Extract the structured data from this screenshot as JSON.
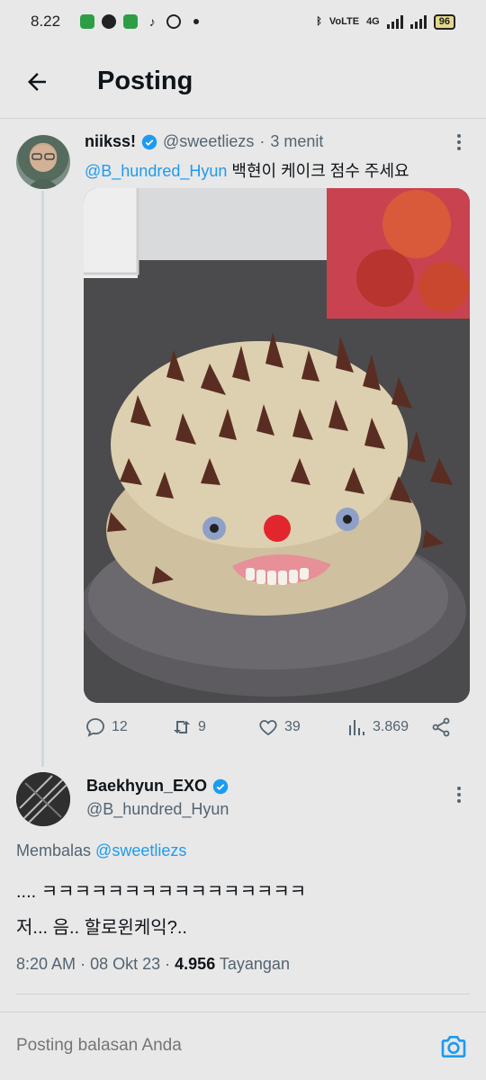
{
  "status_bar": {
    "time": "8.22",
    "network": "4G",
    "volte": "VoLTE",
    "battery": "96"
  },
  "header": {
    "title": "Posting"
  },
  "tweet": {
    "name": "niikss!",
    "handle": "@sweetliezs",
    "separator": "·",
    "time": "3 menit",
    "mention": "@B_hundred_Hyun",
    "text": "백현이 케이크 점수 주세요",
    "actions": {
      "replies": "12",
      "reposts": "9",
      "likes": "39",
      "views": "3.869"
    }
  },
  "reply": {
    "name": "Baekhyun_EXO",
    "handle": "@B_hundred_Hyun",
    "replying_prefix": "Membalas",
    "replying_to": "@sweetliezs",
    "line1": ".... ㅋㅋㅋㅋㅋㅋㅋㅋㅋㅋㅋㅋㅋㅋㅋㅋ",
    "line2": "저... 음.. 할로윈케익?..",
    "time": "8:20 AM",
    "date": "08 Okt 23",
    "views": "4.956",
    "views_label": "Tayangan",
    "meta_sep": "·"
  },
  "composer": {
    "placeholder": "Posting balasan Anda"
  },
  "colors": {
    "accent": "#1d9bf0",
    "background": "#e8e8e8",
    "secondary_text": "#536471"
  }
}
